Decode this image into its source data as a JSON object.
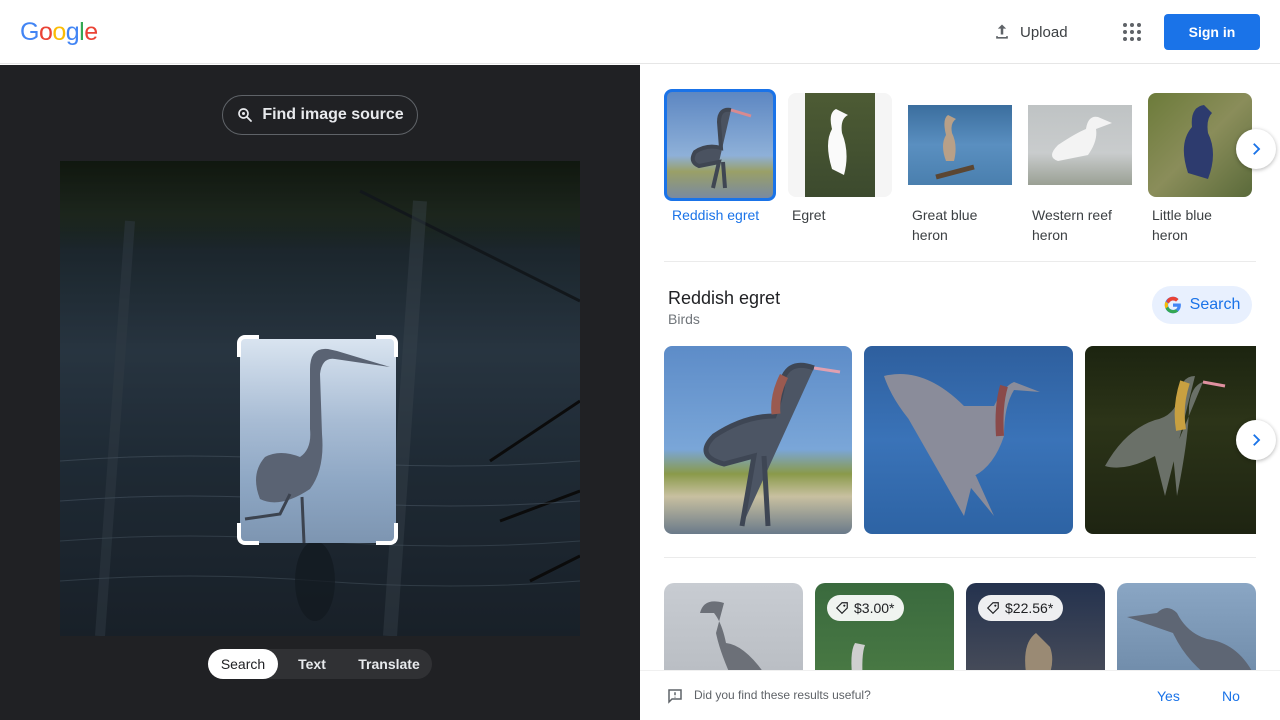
{
  "header": {
    "logo_letters": [
      {
        "ch": "G",
        "color": "#4285f4"
      },
      {
        "ch": "o",
        "color": "#ea4335"
      },
      {
        "ch": "o",
        "color": "#fbbc05"
      },
      {
        "ch": "g",
        "color": "#4285f4"
      },
      {
        "ch": "l",
        "color": "#34a853"
      },
      {
        "ch": "e",
        "color": "#ea4335"
      }
    ],
    "upload_label": "Upload",
    "apps_icon": "apps-grid-icon",
    "signin_label": "Sign in"
  },
  "left": {
    "find_source_label": "Find image source",
    "modes": [
      "Search",
      "Text",
      "Translate"
    ],
    "active_mode": "Search"
  },
  "suggestions": {
    "items": [
      {
        "label": "Reddish egret",
        "selected": true
      },
      {
        "label": "Egret",
        "selected": false
      },
      {
        "label": "Great blue heron",
        "selected": false
      },
      {
        "label": "Western reef heron",
        "selected": false
      },
      {
        "label": "Little blue heron",
        "selected": false
      }
    ]
  },
  "knowledge": {
    "title": "Reddish egret",
    "subtitle": "Birds",
    "search_label": "Search"
  },
  "results": {
    "prices": [
      "$3.00*",
      "$22.56*"
    ]
  },
  "feedback": {
    "question": "Did you find these results useful?",
    "yes": "Yes",
    "no": "No"
  },
  "colors": {
    "accent": "#1a73e8",
    "dark_panel": "#202124"
  }
}
